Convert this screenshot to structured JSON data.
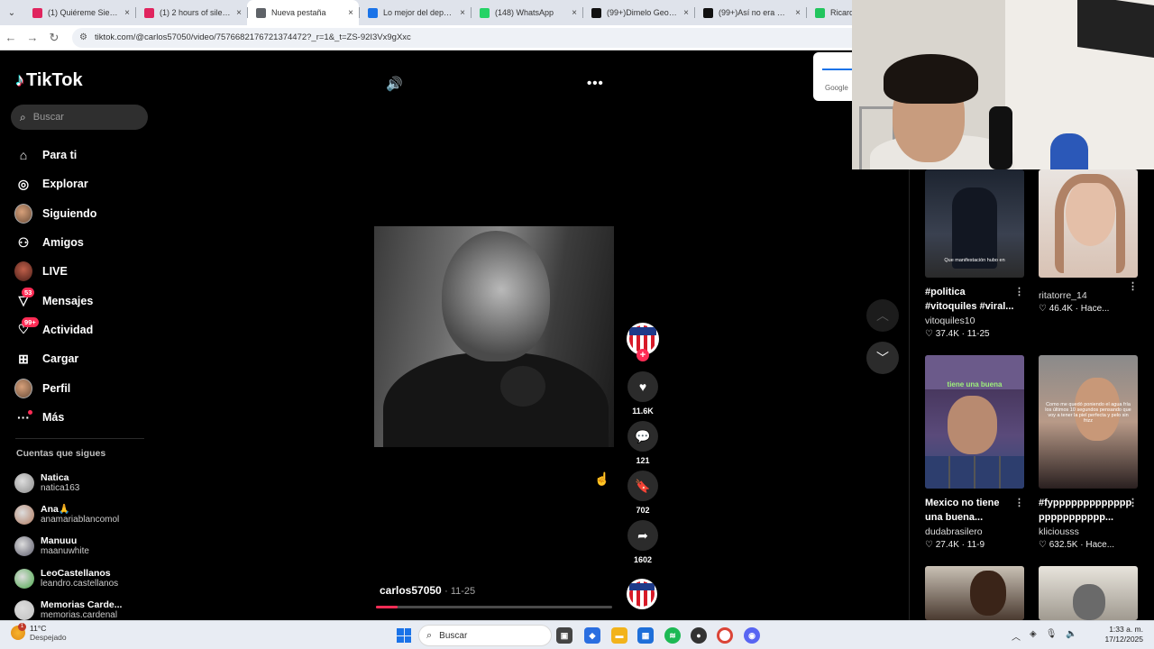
{
  "browser": {
    "tabs": [
      {
        "title": "(1) Quiéreme Siempre",
        "favicon_color": "#e0245e"
      },
      {
        "title": "(1) 2 hours of silence",
        "favicon_color": "#e0245e"
      },
      {
        "title": "Nueva pestaña",
        "favicon_color": "#5f6368",
        "active": true
      },
      {
        "title": "Lo mejor del deporte",
        "favicon_color": "#1a73e8"
      },
      {
        "title": "(148) WhatsApp",
        "favicon_color": "#25d366"
      },
      {
        "title": "(99+)Dimelo George",
        "favicon_color": "#111111"
      },
      {
        "title": "(99+)Así no era @Inc",
        "favicon_color": "#111111"
      },
      {
        "title": "RicardoEs",
        "favicon_color": "#22c55e"
      }
    ],
    "url": "tiktok.com/@carlos57050/video/7576682176721374472?_r=1&_t=ZS-92I3Vx9gXxc"
  },
  "sidebar": {
    "logo": "TikTok",
    "search_placeholder": "Buscar",
    "nav": [
      {
        "label": "Para ti",
        "icon": "home-icon"
      },
      {
        "label": "Explorar",
        "icon": "compass-icon"
      },
      {
        "label": "Siguiendo",
        "icon": "avatar"
      },
      {
        "label": "Amigos",
        "icon": "friends-icon"
      },
      {
        "label": "LIVE",
        "icon": "live-avatar"
      },
      {
        "label": "Mensajes",
        "icon": "messages-icon",
        "badge": "53"
      },
      {
        "label": "Actividad",
        "icon": "activity-icon",
        "badge": "99+"
      },
      {
        "label": "Cargar",
        "icon": "upload-icon"
      },
      {
        "label": "Perfil",
        "icon": "avatar"
      },
      {
        "label": "Más",
        "icon": "more-icon"
      }
    ],
    "following_title": "Cuentas que sigues",
    "following": [
      {
        "name": "Natica",
        "handle": "natica163"
      },
      {
        "name": "Ana🙏",
        "handle": "anamariablancomol"
      },
      {
        "name": "Manuuu",
        "handle": "maanuwhite"
      },
      {
        "name": "LeoCastellanos",
        "handle": "leandro.castellanos"
      },
      {
        "name": "Memorias Carde...",
        "handle": "memorias.cardenal"
      }
    ]
  },
  "video": {
    "creator": "carlos57050",
    "date": "11-25",
    "progress": 0.09,
    "likes": "11.6K",
    "comments": "121",
    "saves": "702",
    "shares": "1602"
  },
  "google_popup": {
    "label": "Google"
  },
  "recommended": [
    {
      "desc": "#politica #vitoquiles #viral...",
      "user": "vitoquiles10",
      "likes": "37.4K",
      "date": "11-25",
      "caption": "Que manifestación hubo en"
    },
    {
      "desc": "",
      "user": "ritatorre_14",
      "likes": "46.4K",
      "date": "Hace..."
    },
    {
      "desc": "Mexico no tiene una buena...",
      "user": "dudabrasilero",
      "likes": "27.4K",
      "date": "11-9",
      "caption": "tiene una buena"
    },
    {
      "desc": "#fypppppppppppppppppppppppp...",
      "user": "kliciousss",
      "likes": "632.5K",
      "date": "Hace...",
      "caption": "Como me quedó poniendo el agua fría los últimos 10 segundos pensando que voy a tener la piel perfecta y pelo sin frizz"
    }
  ],
  "taskbar": {
    "temp": "11°C",
    "condition": "Despejado",
    "weather_badge": "1",
    "search_label": "Buscar",
    "time": "1:33 a. m.",
    "date": "17/12/2025"
  }
}
